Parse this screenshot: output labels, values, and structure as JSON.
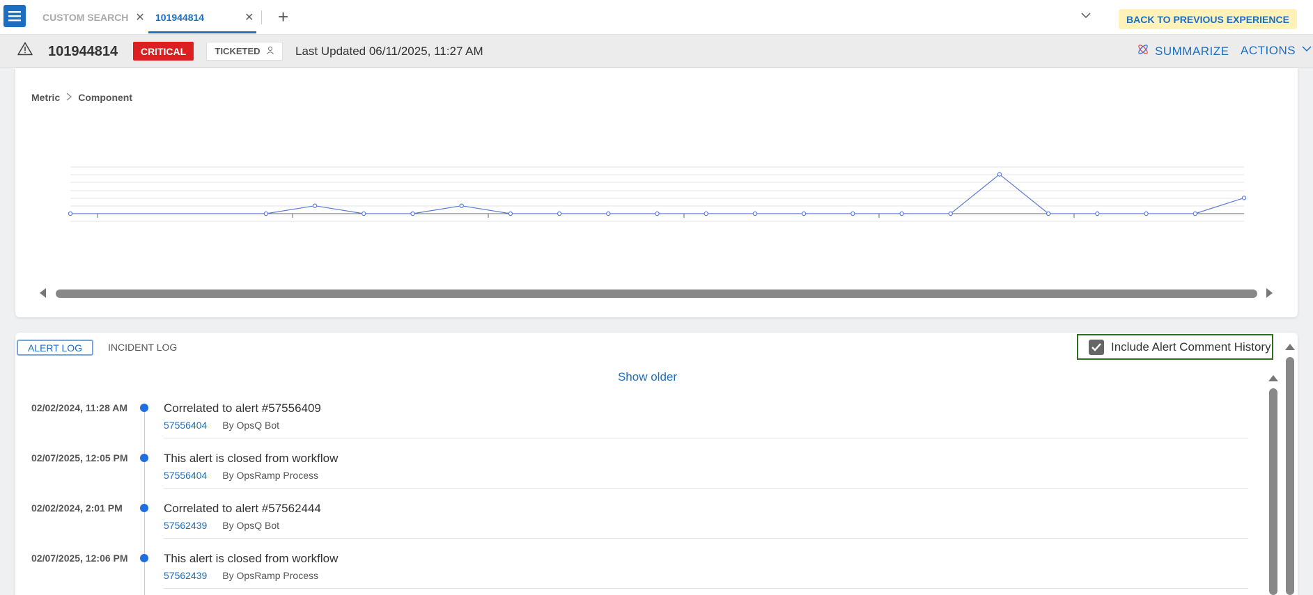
{
  "tabs": {
    "custom_search": "CUSTOM SEARCH",
    "active_tab": "101944814",
    "back_button": "BACK TO PREVIOUS EXPERIENCE"
  },
  "alert": {
    "id": "101944814",
    "severity": "CRITICAL",
    "status": "TICKETED",
    "last_updated": "Last Updated 06/11/2025, 11:27 AM",
    "summarize_label": "SUMMARIZE",
    "actions_label": "ACTIONS"
  },
  "breadcrumb": {
    "level1": "Metric",
    "level2": "Component"
  },
  "chart_data": {
    "type": "line",
    "values": [
      0,
      0,
      1,
      0,
      0,
      1,
      0,
      0,
      0,
      0,
      0,
      0,
      0,
      0,
      0,
      0,
      5,
      0,
      0,
      0,
      0,
      2
    ],
    "point_positions": [
      0,
      4,
      5,
      6,
      7,
      8,
      9,
      10,
      11,
      12,
      13,
      14,
      15,
      16,
      17,
      18,
      19,
      20,
      21,
      22,
      23,
      24
    ],
    "grid": true,
    "color": "#5b7bd5"
  },
  "log": {
    "tab_alert": "ALERT LOG",
    "tab_incident": "INCIDENT LOG",
    "include_label": "Include Alert Comment History",
    "include_checked": true,
    "show_older": "Show older",
    "entries": [
      {
        "date": "02/02/2024, 11:28 AM",
        "title": "Correlated to alert #57556409",
        "link": "57556404",
        "by": "By OpsQ Bot"
      },
      {
        "date": "02/07/2025, 12:05 PM",
        "title": "This alert is closed from workflow",
        "link": "57556404",
        "by": "By OpsRamp Process"
      },
      {
        "date": "02/02/2024, 2:01 PM",
        "title": "Correlated to alert #57562444",
        "link": "57562439",
        "by": "By OpsQ Bot"
      },
      {
        "date": "02/07/2025, 12:06 PM",
        "title": "This alert is closed from workflow",
        "link": "57562439",
        "by": "By OpsRamp Process"
      }
    ]
  },
  "icons": {
    "menu": "hamburger-menu-icon",
    "warning": "warning-triangle-icon",
    "user": "user-icon",
    "summarize": "ai-sparkle-icon",
    "chevron": "chevron-down-icon"
  }
}
